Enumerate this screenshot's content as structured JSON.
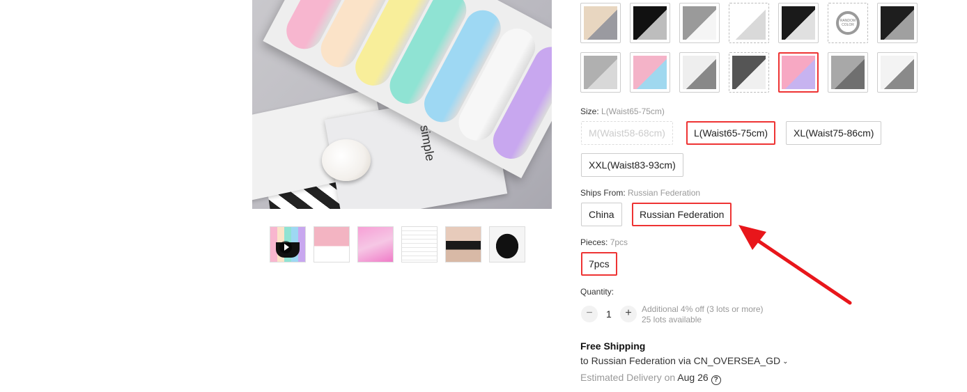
{
  "thumbnails": [
    {
      "name": "thumb-video",
      "kind": "video"
    },
    {
      "name": "thumb-2"
    },
    {
      "name": "thumb-3"
    },
    {
      "name": "thumb-4"
    },
    {
      "name": "thumb-5"
    },
    {
      "name": "thumb-6"
    }
  ],
  "color_options": [
    {
      "colors": [
        "#e8d6c0",
        "#9a9aa0"
      ]
    },
    {
      "colors": [
        "#111111",
        "#bdbdbd"
      ]
    },
    {
      "colors": [
        "#9a9a9a",
        "#f5f5f5"
      ]
    },
    {
      "colors": [
        "#ffffff",
        "#d9d9d9"
      ]
    },
    {
      "colors": [
        "#1a1a1a",
        "#e0e0e0"
      ]
    },
    {
      "colors": [
        "#ffffff",
        "#9a9a9a"
      ],
      "label": "RANDOM COLOR"
    },
    {
      "colors": [
        "#1e1e1e",
        "#a0a0a0"
      ]
    },
    {
      "colors": [
        "#b0b0b0",
        "#d8d8d8"
      ]
    },
    {
      "colors": [
        "#f4b3c8",
        "#9fd8ef"
      ]
    },
    {
      "colors": [
        "#eeeeee",
        "#888888"
      ]
    },
    {
      "colors": [
        "#555555",
        "#f0f0f0"
      ]
    },
    {
      "colors": [
        "#f7a8c3",
        "#c7b3f0"
      ],
      "selected": true
    },
    {
      "colors": [
        "#a8a8a8",
        "#6f6f6f"
      ]
    },
    {
      "colors": [
        "#f3f3f3",
        "#8a8a8a"
      ]
    }
  ],
  "size": {
    "label": "Size: ",
    "selected": "L(Waist65-75cm)",
    "options": [
      "M(Waist58-68cm)",
      "L(Waist65-75cm)",
      "XL(Waist75-86cm)",
      "XXL(Waist83-93cm)"
    ]
  },
  "ships_from": {
    "label": "Ships From: ",
    "selected": "Russian Federation",
    "options": [
      "China",
      "Russian Federation"
    ]
  },
  "pieces": {
    "label": "Pieces: ",
    "selected": "7pcs",
    "options": [
      "7pcs"
    ]
  },
  "quantity": {
    "label": "Quantity:",
    "minus": "−",
    "value": "1",
    "plus": "+",
    "discount_note": "Additional 4% off (3 lots or more)",
    "available_note": "25 lots available"
  },
  "shipping": {
    "title": "Free Shipping",
    "line": "to Russian Federation via CN_OVERSEA_GD",
    "chevron": "⌄",
    "delivery_prefix": "Estimated Delivery on ",
    "delivery_date": "Aug 26",
    "help": "?"
  },
  "main_image": {
    "box_text": "simple",
    "roll_colors": [
      "#f7b6cf",
      "#fbe3c8",
      "#f8ee9a",
      "#8fe3d3",
      "#9ed8f3",
      "#f7f7f7",
      "#c8a7ef"
    ]
  },
  "accent": "#e33333",
  "annotation_arrow_color": "#e8161b"
}
